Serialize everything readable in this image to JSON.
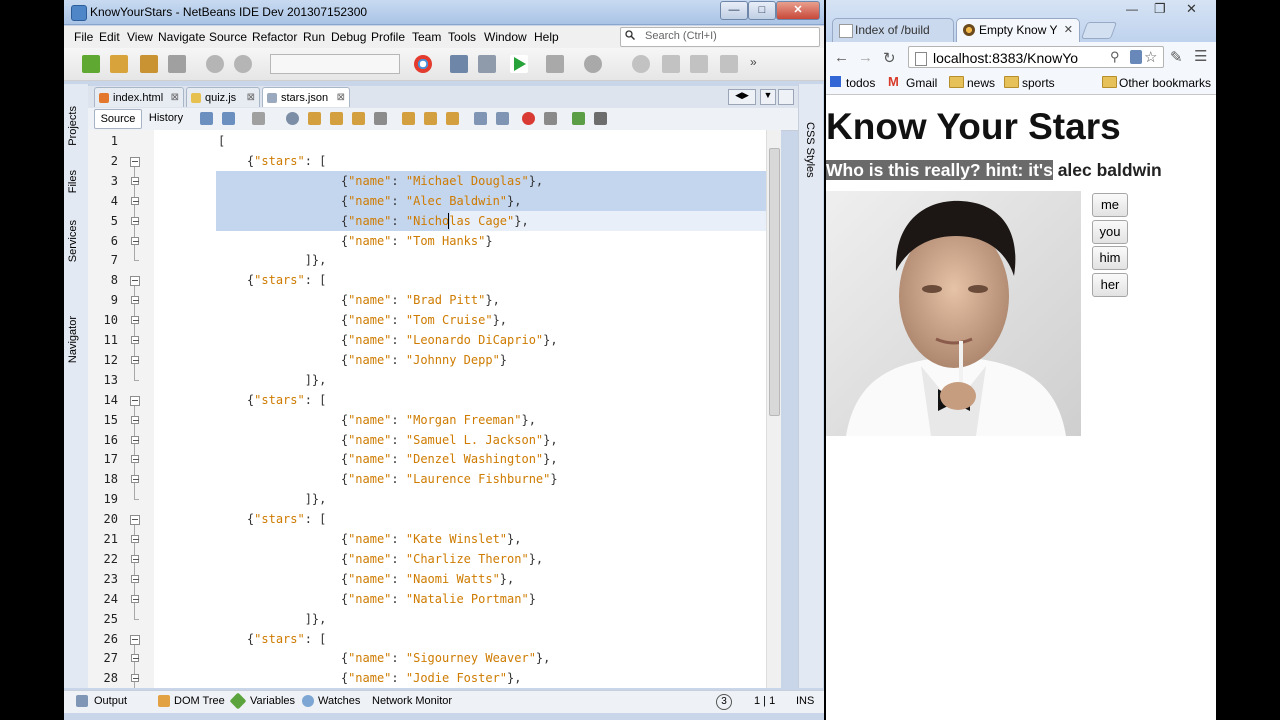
{
  "netbeans": {
    "title": "KnowYourStars - NetBeans IDE Dev 201307152300",
    "menu": [
      "File",
      "Edit",
      "View",
      "Navigate",
      "Source",
      "Refactor",
      "Run",
      "Debug",
      "Profile",
      "Team",
      "Tools",
      "Window",
      "Help"
    ],
    "search_placeholder": "Search (Ctrl+I)",
    "left_panels": [
      "Projects",
      "Files",
      "Services",
      "Navigator"
    ],
    "right_panels": [
      "CSS Styles"
    ],
    "tabs": [
      {
        "label": "index.html",
        "active": false
      },
      {
        "label": "quiz.js",
        "active": false
      },
      {
        "label": "stars.json",
        "active": true
      }
    ],
    "editor_toolbar": {
      "source": "Source",
      "history": "History"
    },
    "lines": [
      {
        "n": "1",
        "indent": "",
        "parts": [
          [
            "p",
            "["
          ]
        ]
      },
      {
        "n": "2",
        "indent": "    ",
        "parts": [
          [
            "p",
            "{"
          ],
          [
            "s",
            "\"stars\""
          ],
          [
            "p",
            ": ["
          ]
        ]
      },
      {
        "n": "3",
        "indent": "                 ",
        "parts": [
          [
            "p",
            "{"
          ],
          [
            "s",
            "\"name\""
          ],
          [
            "p",
            ": "
          ],
          [
            "s",
            "\"Michael Douglas\""
          ],
          [
            "p",
            "},"
          ]
        ]
      },
      {
        "n": "4",
        "indent": "                 ",
        "parts": [
          [
            "p",
            "{"
          ],
          [
            "s",
            "\"name\""
          ],
          [
            "p",
            ": "
          ],
          [
            "s",
            "\"Alec Baldwin\""
          ],
          [
            "p",
            "},"
          ]
        ]
      },
      {
        "n": "5",
        "indent": "                 ",
        "parts": [
          [
            "p",
            "{"
          ],
          [
            "s",
            "\"name\""
          ],
          [
            "p",
            ": "
          ],
          [
            "s",
            "\"Nicholas Cage\""
          ],
          [
            "p",
            "},"
          ]
        ]
      },
      {
        "n": "6",
        "indent": "                 ",
        "parts": [
          [
            "p",
            "{"
          ],
          [
            "s",
            "\"name\""
          ],
          [
            "p",
            ": "
          ],
          [
            "s",
            "\"Tom Hanks\""
          ],
          [
            "p",
            "}"
          ]
        ]
      },
      {
        "n": "7",
        "indent": "            ",
        "parts": [
          [
            "p",
            "]},"
          ]
        ]
      },
      {
        "n": "8",
        "indent": "    ",
        "parts": [
          [
            "p",
            "{"
          ],
          [
            "s",
            "\"stars\""
          ],
          [
            "p",
            ": ["
          ]
        ]
      },
      {
        "n": "9",
        "indent": "                 ",
        "parts": [
          [
            "p",
            "{"
          ],
          [
            "s",
            "\"name\""
          ],
          [
            "p",
            ": "
          ],
          [
            "s",
            "\"Brad Pitt\""
          ],
          [
            "p",
            "},"
          ]
        ]
      },
      {
        "n": "10",
        "indent": "                 ",
        "parts": [
          [
            "p",
            "{"
          ],
          [
            "s",
            "\"name\""
          ],
          [
            "p",
            ": "
          ],
          [
            "s",
            "\"Tom Cruise\""
          ],
          [
            "p",
            "},"
          ]
        ]
      },
      {
        "n": "11",
        "indent": "                 ",
        "parts": [
          [
            "p",
            "{"
          ],
          [
            "s",
            "\"name\""
          ],
          [
            "p",
            ": "
          ],
          [
            "s",
            "\"Leonardo DiCaprio\""
          ],
          [
            "p",
            "},"
          ]
        ]
      },
      {
        "n": "12",
        "indent": "                 ",
        "parts": [
          [
            "p",
            "{"
          ],
          [
            "s",
            "\"name\""
          ],
          [
            "p",
            ": "
          ],
          [
            "s",
            "\"Johnny Depp\""
          ],
          [
            "p",
            "}"
          ]
        ]
      },
      {
        "n": "13",
        "indent": "            ",
        "parts": [
          [
            "p",
            "]},"
          ]
        ]
      },
      {
        "n": "14",
        "indent": "    ",
        "parts": [
          [
            "p",
            "{"
          ],
          [
            "s",
            "\"stars\""
          ],
          [
            "p",
            ": ["
          ]
        ]
      },
      {
        "n": "15",
        "indent": "                 ",
        "parts": [
          [
            "p",
            "{"
          ],
          [
            "s",
            "\"name\""
          ],
          [
            "p",
            ": "
          ],
          [
            "s",
            "\"Morgan Freeman\""
          ],
          [
            "p",
            "},"
          ]
        ]
      },
      {
        "n": "16",
        "indent": "                 ",
        "parts": [
          [
            "p",
            "{"
          ],
          [
            "s",
            "\"name\""
          ],
          [
            "p",
            ": "
          ],
          [
            "s",
            "\"Samuel L. Jackson\""
          ],
          [
            "p",
            "},"
          ]
        ]
      },
      {
        "n": "17",
        "indent": "                 ",
        "parts": [
          [
            "p",
            "{"
          ],
          [
            "s",
            "\"name\""
          ],
          [
            "p",
            ": "
          ],
          [
            "s",
            "\"Denzel Washington\""
          ],
          [
            "p",
            "},"
          ]
        ]
      },
      {
        "n": "18",
        "indent": "                 ",
        "parts": [
          [
            "p",
            "{"
          ],
          [
            "s",
            "\"name\""
          ],
          [
            "p",
            ": "
          ],
          [
            "s",
            "\"Laurence Fishburne\""
          ],
          [
            "p",
            "}"
          ]
        ]
      },
      {
        "n": "19",
        "indent": "            ",
        "parts": [
          [
            "p",
            "]},"
          ]
        ]
      },
      {
        "n": "20",
        "indent": "    ",
        "parts": [
          [
            "p",
            "{"
          ],
          [
            "s",
            "\"stars\""
          ],
          [
            "p",
            ": ["
          ]
        ]
      },
      {
        "n": "21",
        "indent": "                 ",
        "parts": [
          [
            "p",
            "{"
          ],
          [
            "s",
            "\"name\""
          ],
          [
            "p",
            ": "
          ],
          [
            "s",
            "\"Kate Winslet\""
          ],
          [
            "p",
            "},"
          ]
        ]
      },
      {
        "n": "22",
        "indent": "                 ",
        "parts": [
          [
            "p",
            "{"
          ],
          [
            "s",
            "\"name\""
          ],
          [
            "p",
            ": "
          ],
          [
            "s",
            "\"Charlize Theron\""
          ],
          [
            "p",
            "},"
          ]
        ]
      },
      {
        "n": "23",
        "indent": "                 ",
        "parts": [
          [
            "p",
            "{"
          ],
          [
            "s",
            "\"name\""
          ],
          [
            "p",
            ": "
          ],
          [
            "s",
            "\"Naomi Watts\""
          ],
          [
            "p",
            "},"
          ]
        ]
      },
      {
        "n": "24",
        "indent": "                 ",
        "parts": [
          [
            "p",
            "{"
          ],
          [
            "s",
            "\"name\""
          ],
          [
            "p",
            ": "
          ],
          [
            "s",
            "\"Natalie Portman\""
          ],
          [
            "p",
            "}"
          ]
        ]
      },
      {
        "n": "25",
        "indent": "            ",
        "parts": [
          [
            "p",
            "]},"
          ]
        ]
      },
      {
        "n": "26",
        "indent": "    ",
        "parts": [
          [
            "p",
            "{"
          ],
          [
            "s",
            "\"stars\""
          ],
          [
            "p",
            ": ["
          ]
        ]
      },
      {
        "n": "27",
        "indent": "                 ",
        "parts": [
          [
            "p",
            "{"
          ],
          [
            "s",
            "\"name\""
          ],
          [
            "p",
            ": "
          ],
          [
            "s",
            "\"Sigourney Weaver\""
          ],
          [
            "p",
            "},"
          ]
        ]
      },
      {
        "n": "28",
        "indent": "                 ",
        "parts": [
          [
            "p",
            "{"
          ],
          [
            "s",
            "\"name\""
          ],
          [
            "p",
            ": "
          ],
          [
            "s",
            "\"Jodie Foster\""
          ],
          [
            "p",
            "},"
          ]
        ]
      }
    ],
    "bottom_tabs": [
      "Output",
      "DOM Tree",
      "Variables",
      "Watches",
      "Network Monitor"
    ],
    "status": {
      "notifications": "3",
      "position": "1 | 1",
      "mode": "INS"
    }
  },
  "browser": {
    "tabs": [
      {
        "label": "Index of /build",
        "active": false
      },
      {
        "label": "Empty Know Y",
        "active": true
      }
    ],
    "url": "localhost:8383/KnowYo",
    "bookmarks": [
      "todos",
      "Gmail",
      "news",
      "sports"
    ],
    "other_bookmarks": "Other bookmarks",
    "page": {
      "heading": "Know Your Stars",
      "hint_selected": "Who is this really? hint: it's",
      "hint_rest": " alec baldwin",
      "buttons": [
        "me",
        "you",
        "him",
        "her"
      ]
    },
    "colors": {
      "string": "#ce7b00",
      "selection": "#c4d5ee"
    }
  }
}
